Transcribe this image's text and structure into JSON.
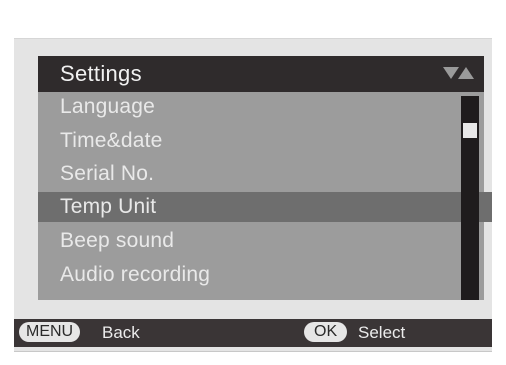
{
  "menu": {
    "title": "Settings",
    "items": [
      {
        "label": "Language",
        "selected": false
      },
      {
        "label": "Time&date",
        "selected": false
      },
      {
        "label": "Serial No.",
        "selected": false
      },
      {
        "label": "Temp Unit",
        "selected": true
      },
      {
        "label": "Beep sound",
        "selected": false
      },
      {
        "label": "Audio recording",
        "selected": false
      }
    ]
  },
  "footer": {
    "menu_key": "MENU",
    "back_label": "Back",
    "ok_key": "OK",
    "select_label": "Select"
  },
  "colors": {
    "panel": "#9c9c9c",
    "header": "#2f2b2c",
    "selected_row": "#6e6e6e",
    "footer": "#3a3536",
    "text": "#e9e9e9"
  }
}
